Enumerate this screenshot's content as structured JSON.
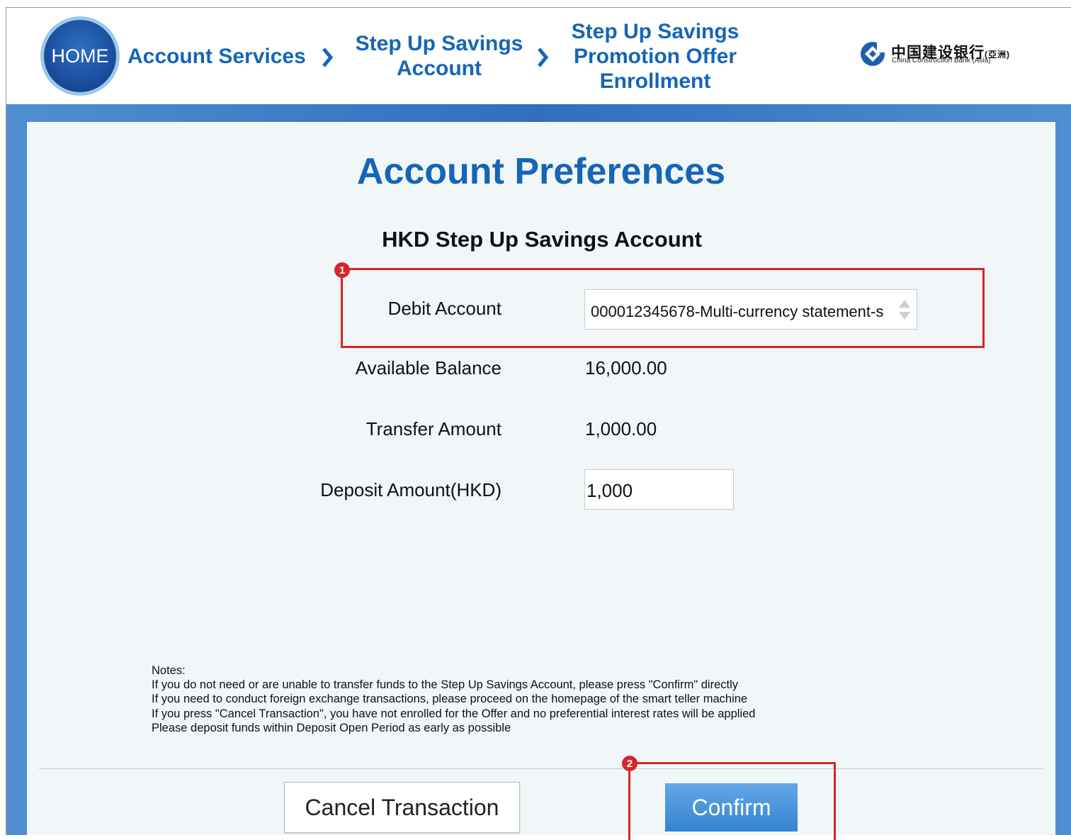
{
  "header": {
    "home_label": "HOME",
    "breadcrumbs": [
      "Account Services",
      "Step Up Savings\nAccount",
      "Step Up Savings\nPromotion Offer\nEnrollment"
    ],
    "logo": {
      "cn": "中国建设银行",
      "cn_suffix": "(亞洲)",
      "en": "China Construction Bank (Asia)"
    }
  },
  "main": {
    "title": "Account Preferences",
    "subtitle": "HKD Step Up Savings Account",
    "debit_account_label": "Debit Account",
    "debit_account_value": "000012345678-Multi-currency statement-s",
    "available_balance_label": "Available Balance",
    "available_balance_value": "16,000.00",
    "transfer_amount_label": "Transfer Amount",
    "transfer_amount_value": "1,000.00",
    "deposit_amount_label": "Deposit Amount(HKD)",
    "deposit_amount_value": "1,000"
  },
  "notes": {
    "heading": "Notes:",
    "lines": [
      "If you do not need or are unable to transfer funds to the Step Up Savings Account, please press \"Confirm\" directly",
      "If you need to conduct foreign exchange transactions, please proceed on the homepage of the smart teller machine",
      "If you press \"Cancel Transaction\", you have not enrolled for the Offer and no preferential interest rates will be applied",
      "Please deposit funds within Deposit Open Period as early as possible"
    ]
  },
  "buttons": {
    "cancel": "Cancel Transaction",
    "confirm": "Confirm"
  },
  "annotations": {
    "marker_1": "1",
    "marker_2": "2"
  },
  "colors": {
    "brand_blue": "#1565b8",
    "highlight_red": "#d72627",
    "confirm_blue": "#3583d2"
  }
}
